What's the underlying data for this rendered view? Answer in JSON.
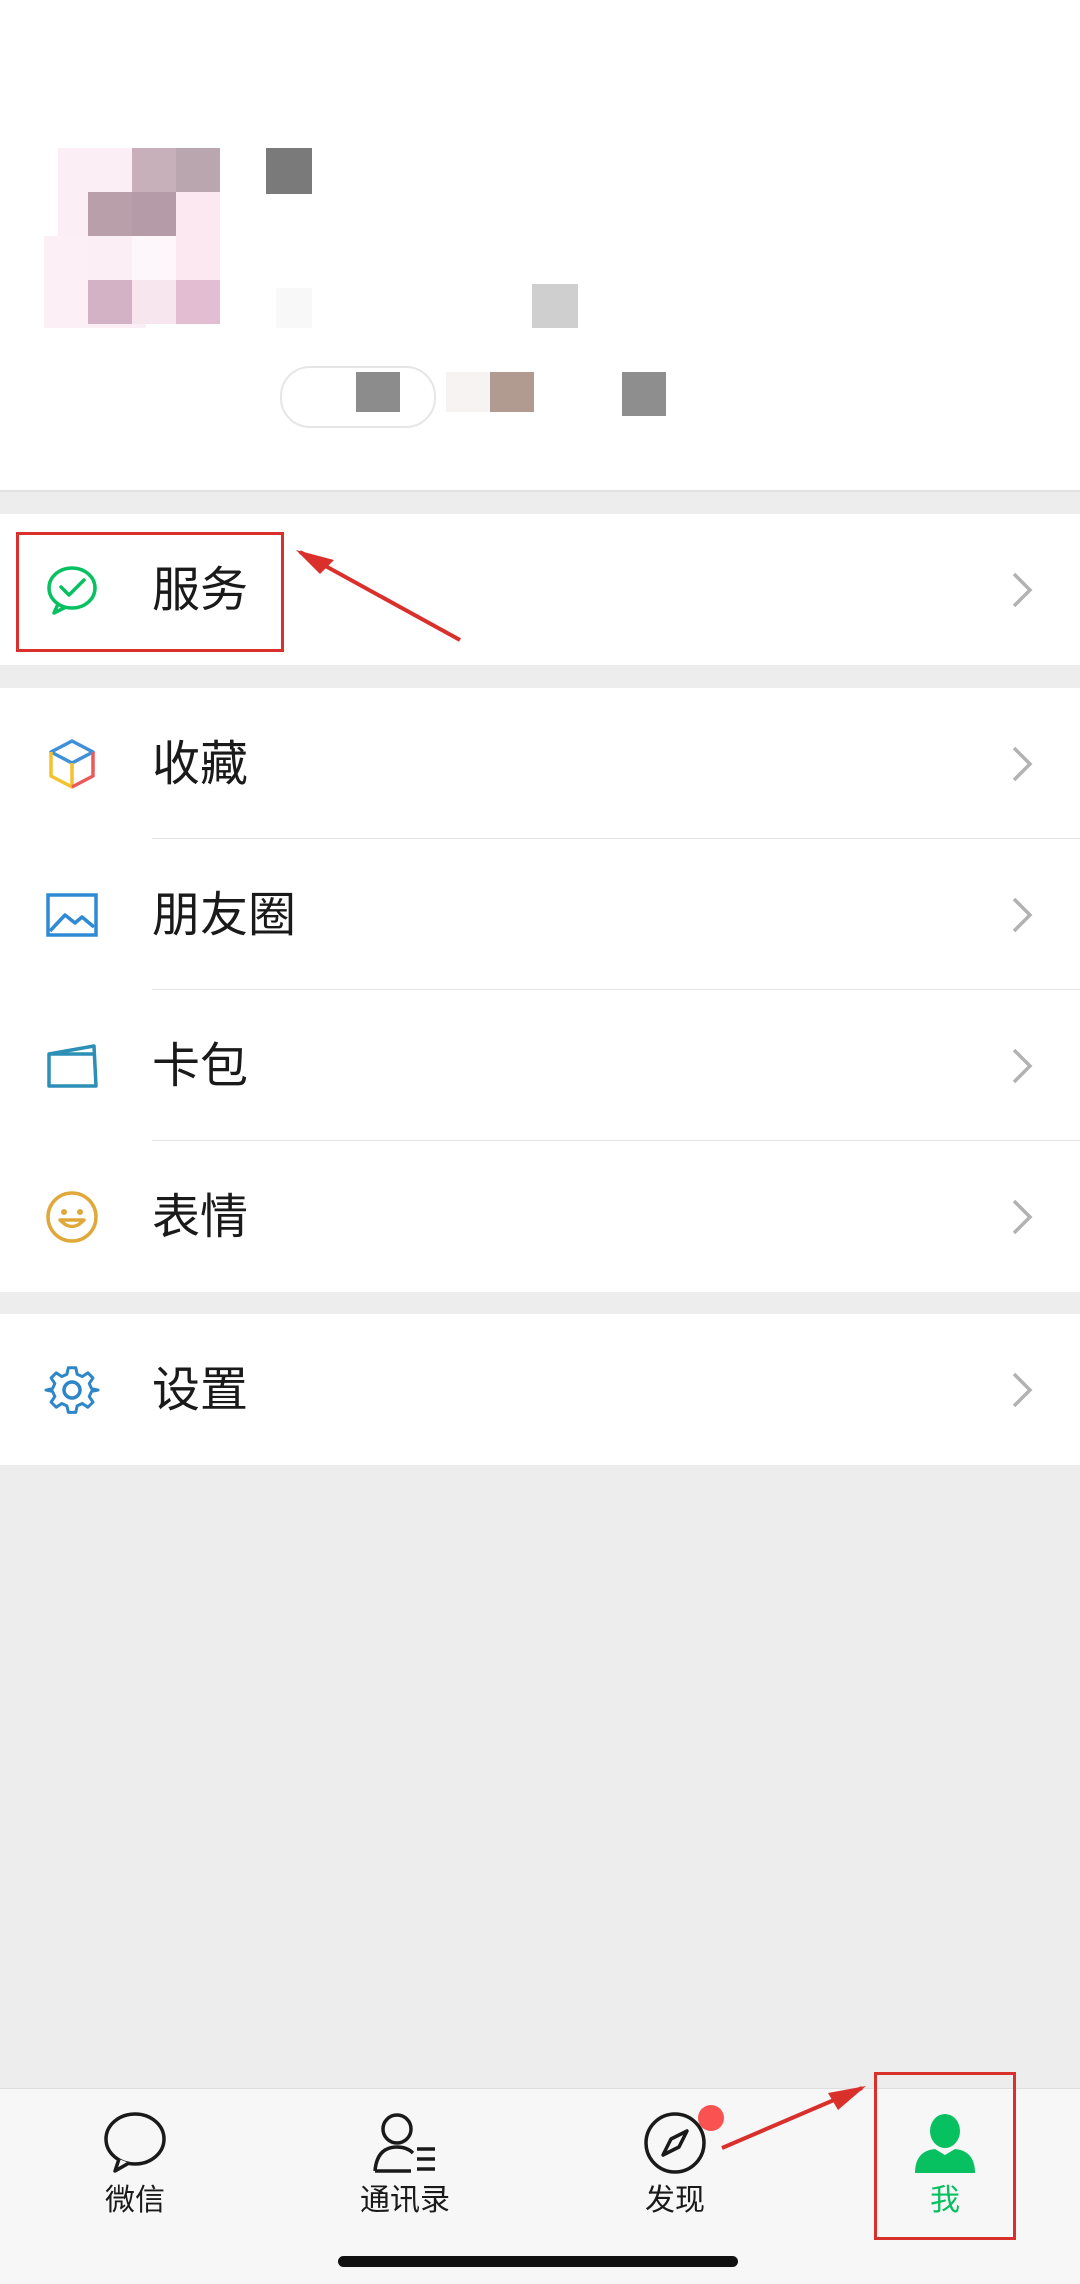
{
  "menu": {
    "services": {
      "label": "服务",
      "icon": "wechat-pay-icon"
    },
    "favorites": {
      "label": "收藏",
      "icon": "cube-icon"
    },
    "moments": {
      "label": "朋友圈",
      "icon": "picture-icon"
    },
    "cards": {
      "label": "卡包",
      "icon": "card-wallet-icon"
    },
    "stickers": {
      "label": "表情",
      "icon": "smiley-icon"
    },
    "settings": {
      "label": "设置",
      "icon": "gear-icon"
    }
  },
  "tabbar": {
    "tabs": [
      {
        "label": "微信",
        "icon": "chat-bubble-icon"
      },
      {
        "label": "通讯录",
        "icon": "contacts-icon"
      },
      {
        "label": "发现",
        "icon": "compass-icon"
      },
      {
        "label": "我",
        "icon": "person-icon"
      }
    ],
    "active_index": 3
  },
  "colors": {
    "accent_green": "#07c160",
    "annotation_red": "#d9302c",
    "badge_red": "#fa5151",
    "background": "#ededed"
  }
}
